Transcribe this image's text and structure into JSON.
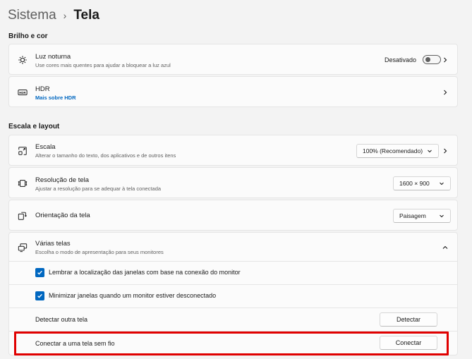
{
  "breadcrumb": {
    "parent": "Sistema",
    "separator": "›",
    "current": "Tela"
  },
  "sections": {
    "brightness": "Brilho e cor",
    "scale_layout": "Escala e layout"
  },
  "night_light": {
    "title": "Luz noturna",
    "subtitle": "Use cores mais quentes para ajudar a bloquear a luz azul",
    "state": "Desativado",
    "icon": "brightness-icon"
  },
  "hdr": {
    "title": "HDR",
    "link": "Mais sobre HDR",
    "icon": "hdr-icon"
  },
  "scale": {
    "title": "Escala",
    "subtitle": "Alterar o tamanho do texto, dos aplicativos e de outros itens",
    "value": "100% (Recomendado)",
    "icon": "scale-icon"
  },
  "resolution": {
    "title": "Resolução de tela",
    "subtitle": "Ajustar a resolução para se adequar à tela conectada",
    "value": "1600 × 900",
    "icon": "resolution-icon"
  },
  "orientation": {
    "title": "Orientação da tela",
    "value": "Paisagem",
    "icon": "orientation-icon"
  },
  "multi": {
    "title": "Várias telas",
    "subtitle": "Escolha o modo de apresentação para seus monitores",
    "icon": "multiple-displays-icon",
    "remember": "Lembrar a localização das janelas com base na conexão do monitor",
    "minimize": "Minimizar janelas quando um monitor estiver desconectado",
    "detect_label": "Detectar outra tela",
    "detect_button": "Detectar",
    "connect_label": "Conectar a uma tela sem fio",
    "connect_button": "Conectar"
  },
  "colors": {
    "accent": "#0067c0",
    "highlight": "#e00000"
  }
}
